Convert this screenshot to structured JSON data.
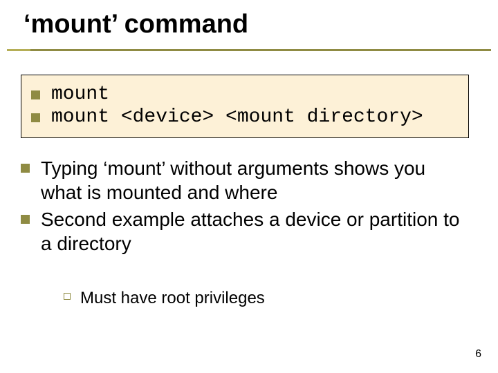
{
  "title": "‘mount’ command",
  "code_box": {
    "items": [
      "mount",
      "mount <device> <mount directory>"
    ]
  },
  "body": {
    "items": [
      "Typing ‘mount’ without arguments shows you what is mounted and where",
      "Second example attaches a device or partition to a directory"
    ]
  },
  "sub_list": {
    "items": [
      "Must have root privileges"
    ]
  },
  "page_number": "6"
}
